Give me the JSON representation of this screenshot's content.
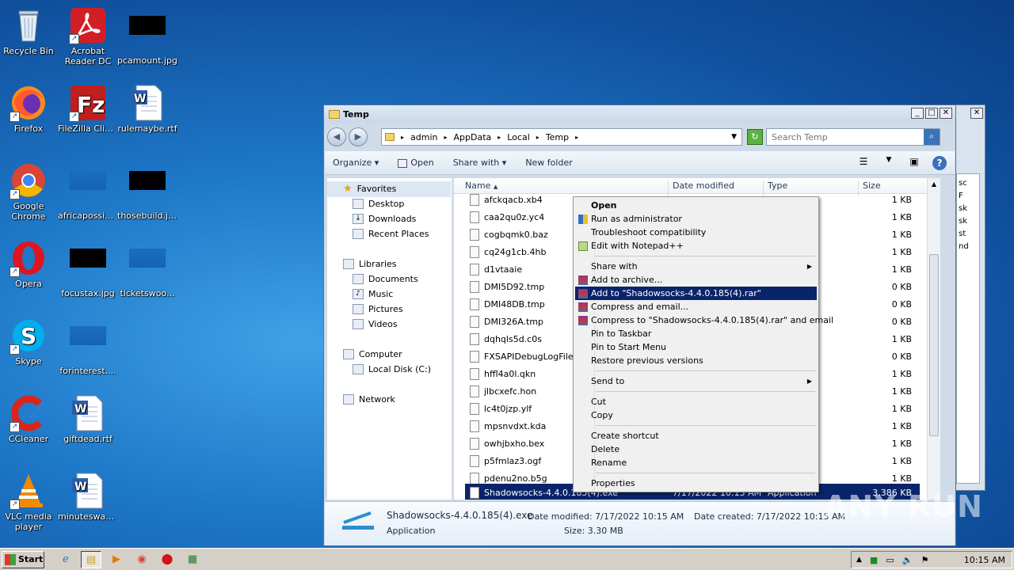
{
  "desktop": {
    "icons": [
      {
        "label": "Recycle Bin"
      },
      {
        "label": "Acrobat Reader DC"
      },
      {
        "label": "pcamount.jpg"
      },
      {
        "label": "Firefox"
      },
      {
        "label": "FileZilla Client"
      },
      {
        "label": "rulemaybe.rtf"
      },
      {
        "label": "Google Chrome"
      },
      {
        "label": "africapossib..."
      },
      {
        "label": "thosebuild.jpg"
      },
      {
        "label": "Opera"
      },
      {
        "label": "focustax.jpg"
      },
      {
        "label": "ticketswoo..."
      },
      {
        "label": "Skype"
      },
      {
        "label": "forinterest...."
      },
      {
        "label": "CCleaner"
      },
      {
        "label": "giftdead.rtf"
      },
      {
        "label": "VLC media player"
      },
      {
        "label": "minuteswas..."
      }
    ]
  },
  "backwindow": {
    "lines": [
      "sc",
      "F",
      "sk",
      "sk",
      "st",
      "nd"
    ]
  },
  "explorer": {
    "title": "Temp",
    "breadcrumb": [
      "admin",
      "AppData",
      "Local",
      "Temp"
    ],
    "search_placeholder": "Search Temp",
    "toolbar": {
      "organize": "Organize",
      "open": "Open",
      "share_with": "Share with",
      "new_folder": "New folder"
    },
    "nav": {
      "favorites": "Favorites",
      "desktop": "Desktop",
      "downloads": "Downloads",
      "recent": "Recent Places",
      "libraries": "Libraries",
      "documents": "Documents",
      "music": "Music",
      "pictures": "Pictures",
      "videos": "Videos",
      "computer": "Computer",
      "local_disk": "Local Disk (C:)",
      "network": "Network"
    },
    "columns": {
      "name": "Name",
      "date": "Date modified",
      "type": "Type",
      "size": "Size"
    },
    "files": [
      {
        "name": "afckqacb.xb4",
        "date": "",
        "type": "",
        "size": "1 KB"
      },
      {
        "name": "caa2qu0z.yc4",
        "date": "",
        "type": "",
        "size": "1 KB"
      },
      {
        "name": "cogbqmk0.baz",
        "date": "",
        "type": "",
        "size": "1 KB"
      },
      {
        "name": "cq24g1cb.4hb",
        "date": "",
        "type": "",
        "size": "1 KB"
      },
      {
        "name": "d1vtaaie",
        "date": "",
        "type": "",
        "size": "1 KB"
      },
      {
        "name": "DMI5D92.tmp",
        "date": "",
        "type": "",
        "size": "0 KB"
      },
      {
        "name": "DMI48DB.tmp",
        "date": "",
        "type": "",
        "size": "0 KB"
      },
      {
        "name": "DMI326A.tmp",
        "date": "",
        "type": "",
        "size": "0 KB"
      },
      {
        "name": "dqhqls5d.c0s",
        "date": "",
        "type": "",
        "size": "1 KB"
      },
      {
        "name": "FXSAPIDebugLogFile.txt",
        "date": "",
        "type": "nt",
        "size": "0 KB"
      },
      {
        "name": "hffl4a0l.qkn",
        "date": "",
        "type": "",
        "size": "1 KB"
      },
      {
        "name": "jlbcxefc.hon",
        "date": "",
        "type": "",
        "size": "1 KB"
      },
      {
        "name": "lc4t0jzp.ylf",
        "date": "",
        "type": "",
        "size": "1 KB"
      },
      {
        "name": "mpsnvdxt.kda",
        "date": "",
        "type": "",
        "size": "1 KB"
      },
      {
        "name": "owhjbxho.bex",
        "date": "",
        "type": "",
        "size": "1 KB"
      },
      {
        "name": "p5fmlaz3.ogf",
        "date": "",
        "type": "",
        "size": "1 KB"
      },
      {
        "name": "pdenu2no.b5g",
        "date": "",
        "type": "",
        "size": "1 KB"
      },
      {
        "name": "Shadowsocks-4.4.0.185(4).exe",
        "date": "7/17/2022 10:15 AM",
        "type": "Application",
        "size": "3,386 KB"
      }
    ],
    "details": {
      "filename": "Shadowsocks-4.4.0.185(4).exe",
      "modified": "Date modified: 7/17/2022 10:15 AM",
      "created": "Date created: 7/17/2022 10:15 AM",
      "type": "Application",
      "size": "Size: 3.30 MB"
    }
  },
  "context_menu": {
    "open": "Open",
    "run_admin": "Run as administrator",
    "troubleshoot": "Troubleshoot compatibility",
    "notepad": "Edit with Notepad++",
    "share_with": "Share with",
    "add_archive": "Add to archive...",
    "add_to_rar": "Add to \"Shadowsocks-4.4.0.185(4).rar\"",
    "compress_email": "Compress and email...",
    "compress_rar_email": "Compress to \"Shadowsocks-4.4.0.185(4).rar\" and email",
    "pin_taskbar": "Pin to Taskbar",
    "pin_start": "Pin to Start Menu",
    "restore": "Restore previous versions",
    "send_to": "Send to",
    "cut": "Cut",
    "copy": "Copy",
    "create_shortcut": "Create shortcut",
    "delete": "Delete",
    "rename": "Rename",
    "properties": "Properties"
  },
  "taskbar": {
    "start": "Start",
    "clock": "10:15 AM"
  },
  "watermark": "ANY RUN"
}
